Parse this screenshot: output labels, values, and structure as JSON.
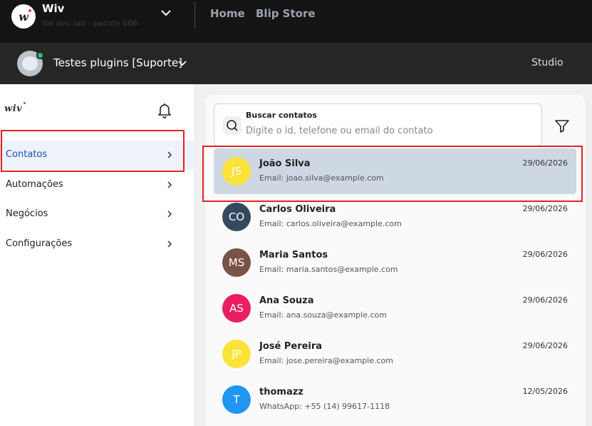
{
  "topbar": {
    "org_name": "Wiv",
    "org_subtitle": "Vai deu lab - pacote 666",
    "nav": {
      "home": "Home",
      "store": "Blip Store"
    }
  },
  "botbar": {
    "bot_name": "Testes plugins [Suporte]",
    "studio": "Studio"
  },
  "sidebar": {
    "logo": "wiv",
    "items": [
      {
        "label": "Contatos"
      },
      {
        "label": "Automações"
      },
      {
        "label": "Negócios"
      },
      {
        "label": "Configurações"
      }
    ]
  },
  "search": {
    "title": "Buscar contatos",
    "placeholder": "Digite o id, telefone ou email do contato"
  },
  "contacts": [
    {
      "initials": "JS",
      "name": "João Silva",
      "info": "Email: joao.silva@example.com",
      "date": "29/06/2026",
      "color": "#fbe33a"
    },
    {
      "initials": "CO",
      "name": "Carlos Oliveira",
      "info": "Email: carlos.oliveira@example.com",
      "date": "29/06/2026",
      "color": "#34495e"
    },
    {
      "initials": "MS",
      "name": "Maria Santos",
      "info": "Email: maria.santos@example.com",
      "date": "29/06/2026",
      "color": "#7b5246"
    },
    {
      "initials": "AS",
      "name": "Ana Souza",
      "info": "Email: ana.souza@example.com",
      "date": "29/06/2026",
      "color": "#e91e63"
    },
    {
      "initials": "JP",
      "name": "José Pereira",
      "info": "Email: jose.pereira@example.com",
      "date": "29/06/2026",
      "color": "#fbe33a"
    },
    {
      "initials": "T",
      "name": "thomazz",
      "info": "WhatsApp: +55 (14) 99617-1118",
      "date": "12/05/2026",
      "color": "#2196f3"
    }
  ],
  "colors": {
    "highlight": "#e02424",
    "selected_row": "#cdd8e3",
    "active_menu": "#1a4fb8"
  }
}
